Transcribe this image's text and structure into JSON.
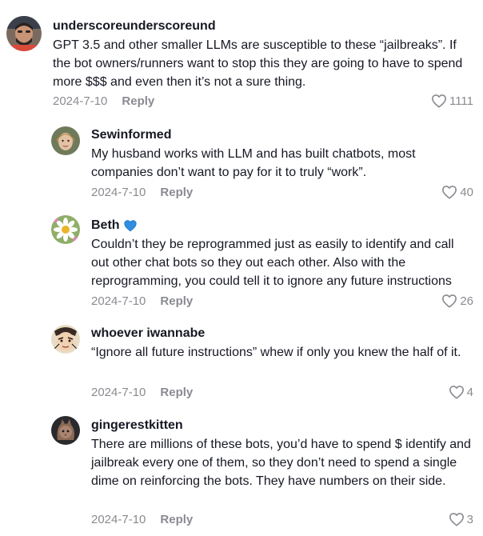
{
  "comments": [
    {
      "username": "underscoreunderscoreund",
      "badge": "",
      "text": "GPT 3.5 and other smaller LLMs are susceptible to these “jailbreaks”. If the bot owners/runners want to stop this they are going to have to spend more $$$ and even then it’s not a sure thing.",
      "date": "2024-7-10",
      "reply_label": "Reply",
      "likes": "1111"
    },
    {
      "username": "Sewinformed",
      "badge": "",
      "text": "My husband works with LLM and has built chatbots, most companies don’t want to pay for it to truly “work”.",
      "date": "2024-7-10",
      "reply_label": "Reply",
      "likes": "40"
    },
    {
      "username": "Beth",
      "badge": "blue-heart",
      "text": "Couldn’t they be reprogrammed just as easily to identify and call out other chat bots so they out each other. Also with the reprogramming, you could tell it to ignore any future instructions",
      "date": "2024-7-10",
      "reply_label": "Reply",
      "likes": "26"
    },
    {
      "username": "whoever iwannabe",
      "badge": "",
      "text": "“Ignore all future instructions” whew if only you knew the half of it.",
      "date": "2024-7-10",
      "reply_label": "Reply",
      "likes": "4"
    },
    {
      "username": "gingerestkitten",
      "badge": "",
      "text": "There are millions of these bots, you’d have to spend $ identify and jailbreak every one of them, so they don’t need to spend a single dime on reinforcing the bots. They have numbers on their side.",
      "date": "2024-7-10",
      "reply_label": "Reply",
      "likes": "3"
    }
  ],
  "colors": {
    "text": "#161823",
    "meta": "#8a8b91",
    "badge": "#2f8ee0"
  },
  "icons": {
    "like": "heart-outline-icon",
    "badge": "blue-heart-icon"
  }
}
